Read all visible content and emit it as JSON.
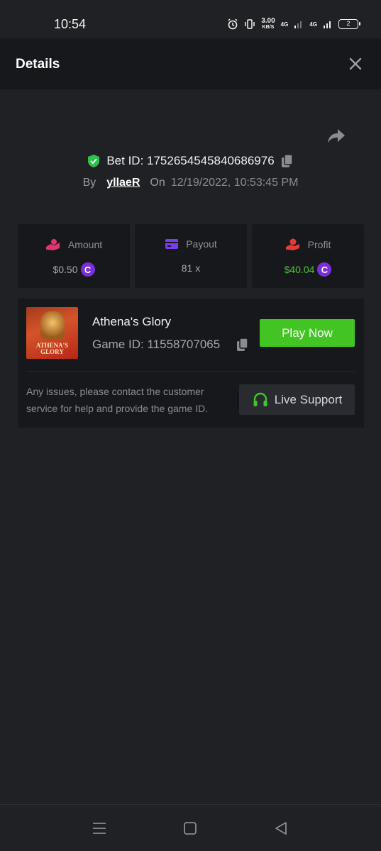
{
  "status_bar": {
    "time": "10:54",
    "speed_value": "3.00",
    "speed_unit": "KB/S",
    "net1": "4G",
    "net2": "4G",
    "battery": "2"
  },
  "header": {
    "title": "Details"
  },
  "bet": {
    "id_label": "Bet ID: 1752654545840686976",
    "by_label": "By",
    "username": "yllaeR",
    "on_label": "On",
    "date": "12/19/2022, 10:53:45 PM"
  },
  "stats": [
    {
      "label": "Amount",
      "value": "$0.50",
      "icon": "hand-coins-icon"
    },
    {
      "label": "Payout",
      "value": "81 x",
      "icon": "card-icon"
    },
    {
      "label": "Profit",
      "value": "$40.04",
      "icon": "hand-money-icon"
    }
  ],
  "coin_symbol": "C",
  "game": {
    "name": "Athena's Glory",
    "id_label": "Game ID: 11558707065",
    "thumb_title": "ATHENA'S GLORY",
    "play_label": "Play Now",
    "help_text": "Any issues, please contact the customer service for help and provide the game ID.",
    "support_label": "Live Support"
  },
  "colors": {
    "accent_green": "#42c522",
    "profit_green": "#4cc63a",
    "coin_purple": "#7b2fd9",
    "verified_green": "#2ec24a"
  }
}
